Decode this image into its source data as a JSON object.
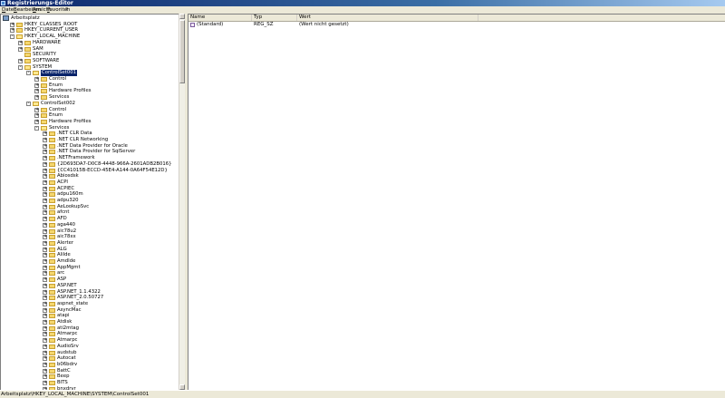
{
  "window": {
    "title": "Registrierungs-Editor"
  },
  "menu": [
    "Datei",
    "Bearbeiten",
    "Ansicht",
    "Favoriten",
    "?"
  ],
  "tree": {
    "root": "Arbeitsplatz",
    "nodes": [
      {
        "label": "HKEY_CLASSES_ROOT",
        "depth": 1,
        "exp": "+"
      },
      {
        "label": "HKEY_CURRENT_USER",
        "depth": 1,
        "exp": "+"
      },
      {
        "label": "HKEY_LOCAL_MACHINE",
        "depth": 1,
        "exp": "-"
      },
      {
        "label": "HARDWARE",
        "depth": 2,
        "exp": "+"
      },
      {
        "label": "SAM",
        "depth": 2,
        "exp": "+"
      },
      {
        "label": "SECURITY",
        "depth": 2,
        "exp": ""
      },
      {
        "label": "SOFTWARE",
        "depth": 2,
        "exp": "+"
      },
      {
        "label": "SYSTEM",
        "depth": 2,
        "exp": "-"
      },
      {
        "label": "ControlSet001",
        "depth": 3,
        "exp": "-",
        "selected": true
      },
      {
        "label": "Control",
        "depth": 4,
        "exp": "+"
      },
      {
        "label": "Enum",
        "depth": 4,
        "exp": "+"
      },
      {
        "label": "Hardware Profiles",
        "depth": 4,
        "exp": "+"
      },
      {
        "label": "Services",
        "depth": 4,
        "exp": "+"
      },
      {
        "label": "ControlSet002",
        "depth": 3,
        "exp": "-"
      },
      {
        "label": "Control",
        "depth": 4,
        "exp": "+"
      },
      {
        "label": "Enum",
        "depth": 4,
        "exp": "+"
      },
      {
        "label": "Hardware Profiles",
        "depth": 4,
        "exp": "+"
      },
      {
        "label": "Services",
        "depth": 4,
        "exp": "-"
      },
      {
        "label": ".NET CLR Data",
        "depth": 5,
        "exp": "+"
      },
      {
        "label": ".NET CLR Networking",
        "depth": 5,
        "exp": "+"
      },
      {
        "label": ".NET Data Provider for Oracle",
        "depth": 5,
        "exp": "+"
      },
      {
        "label": ".NET Data Provider for SqlServer",
        "depth": 5,
        "exp": "+"
      },
      {
        "label": ".NETFramework",
        "depth": 5,
        "exp": "+"
      },
      {
        "label": "{2D693DA7-D0C8-4448-966A-2601ADB2B016}",
        "depth": 5,
        "exp": "+"
      },
      {
        "label": "{CC41015B-ECCD-45E4-A144-0A64F54E12D}",
        "depth": 5,
        "exp": "+"
      },
      {
        "label": "Abiosdsk",
        "depth": 5,
        "exp": "+"
      },
      {
        "label": "ACPI",
        "depth": 5,
        "exp": "+"
      },
      {
        "label": "ACPIEC",
        "depth": 5,
        "exp": "+"
      },
      {
        "label": "adpu160m",
        "depth": 5,
        "exp": "+"
      },
      {
        "label": "adpu320",
        "depth": 5,
        "exp": "+"
      },
      {
        "label": "AeLookupSvc",
        "depth": 5,
        "exp": "+"
      },
      {
        "label": "afcnt",
        "depth": 5,
        "exp": "+"
      },
      {
        "label": "AFD",
        "depth": 5,
        "exp": "+"
      },
      {
        "label": "aga440",
        "depth": 5,
        "exp": "+"
      },
      {
        "label": "aic78u2",
        "depth": 5,
        "exp": "+"
      },
      {
        "label": "aic78xx",
        "depth": 5,
        "exp": "+"
      },
      {
        "label": "Alerter",
        "depth": 5,
        "exp": "+"
      },
      {
        "label": "ALG",
        "depth": 5,
        "exp": "+"
      },
      {
        "label": "AliIde",
        "depth": 5,
        "exp": "+"
      },
      {
        "label": "AmdIde",
        "depth": 5,
        "exp": "+"
      },
      {
        "label": "AppMgmt",
        "depth": 5,
        "exp": "+"
      },
      {
        "label": "arc",
        "depth": 5,
        "exp": "+"
      },
      {
        "label": "ASP",
        "depth": 5,
        "exp": "+"
      },
      {
        "label": "ASP.NET",
        "depth": 5,
        "exp": "+"
      },
      {
        "label": "ASP.NET_1.1.4322",
        "depth": 5,
        "exp": "+"
      },
      {
        "label": "ASP.NET_2.0.50727",
        "depth": 5,
        "exp": "+"
      },
      {
        "label": "aspnet_state",
        "depth": 5,
        "exp": "+"
      },
      {
        "label": "AsyncMac",
        "depth": 5,
        "exp": "+"
      },
      {
        "label": "atapi",
        "depth": 5,
        "exp": "+"
      },
      {
        "label": "Atdisk",
        "depth": 5,
        "exp": "+"
      },
      {
        "label": "ati2mtag",
        "depth": 5,
        "exp": "+"
      },
      {
        "label": "Atmarpc",
        "depth": 5,
        "exp": "+"
      },
      {
        "label": "Atmarpc",
        "depth": 5,
        "exp": "+"
      },
      {
        "label": "AudioSrv",
        "depth": 5,
        "exp": "+"
      },
      {
        "label": "audstub",
        "depth": 5,
        "exp": "+"
      },
      {
        "label": "Autocat",
        "depth": 5,
        "exp": "+"
      },
      {
        "label": "b06bdrv",
        "depth": 5,
        "exp": "+"
      },
      {
        "label": "BattC",
        "depth": 5,
        "exp": "+"
      },
      {
        "label": "Beep",
        "depth": 5,
        "exp": "+"
      },
      {
        "label": "BITS",
        "depth": 5,
        "exp": "+"
      },
      {
        "label": "bnxdrvr",
        "depth": 5,
        "exp": "+"
      }
    ]
  },
  "list": {
    "columns": [
      "Name",
      "Typ",
      "Wert"
    ],
    "rows": [
      {
        "name": "(Standard)",
        "type": "REG_SZ",
        "value": "(Wert nicht gesetzt)"
      }
    ]
  },
  "status": "Arbeitsplatz\\HKEY_LOCAL_MACHINE\\SYSTEM\\ControlSet001"
}
